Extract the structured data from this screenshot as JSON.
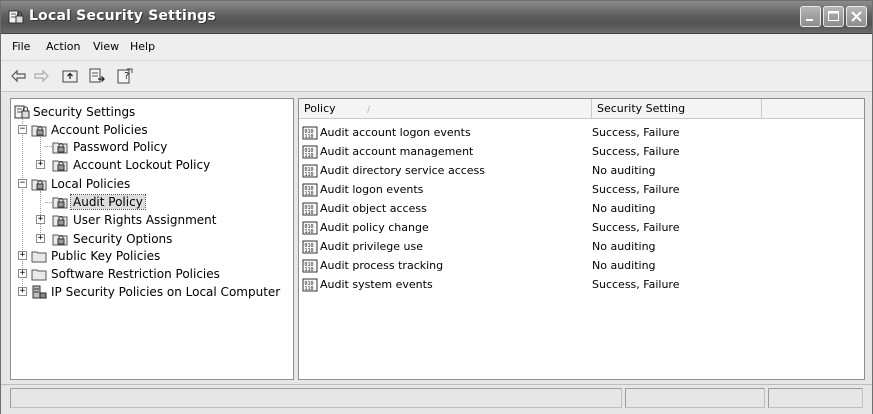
{
  "window": {
    "title": "Local Security Settings",
    "buttons": [
      "minimize-icon",
      "maximize-icon",
      "close-icon"
    ]
  },
  "menubar": {
    "items": [
      {
        "label": "File"
      },
      {
        "label": "Action"
      },
      {
        "label": "View"
      },
      {
        "label": "Help"
      }
    ]
  },
  "toolbar": {
    "icons": [
      "back-arrow-icon",
      "forward-arrow-icon",
      "up-folder-icon",
      "export-list-icon",
      "help-icon"
    ]
  },
  "tree": {
    "root": {
      "label": "Security Settings"
    },
    "account_policies": {
      "label": "Account Policies"
    },
    "password_policy": {
      "label": "Password Policy"
    },
    "account_lockout_policy": {
      "label": "Account Lockout Policy"
    },
    "local_policies": {
      "label": "Local Policies"
    },
    "audit_policy": {
      "label": "Audit Policy"
    },
    "user_rights_assignment": {
      "label": "User Rights Assignment"
    },
    "security_options": {
      "label": "Security Options"
    },
    "public_key_policies": {
      "label": "Public Key Policies"
    },
    "software_restriction_policies": {
      "label": "Software Restriction Policies"
    },
    "ip_security_policies": {
      "label": "IP Security Policies on Local Computer"
    }
  },
  "list": {
    "columns": [
      "Policy",
      "Security Setting"
    ],
    "sort_indicator": "/",
    "rows": [
      {
        "policy": "Audit account logon events",
        "setting": "Success, Failure"
      },
      {
        "policy": "Audit account management",
        "setting": "Success, Failure"
      },
      {
        "policy": "Audit directory service access",
        "setting": "No auditing"
      },
      {
        "policy": "Audit logon events",
        "setting": "Success, Failure"
      },
      {
        "policy": "Audit object access",
        "setting": "No auditing"
      },
      {
        "policy": "Audit policy change",
        "setting": "Success, Failure"
      },
      {
        "policy": "Audit privilege use",
        "setting": "No auditing"
      },
      {
        "policy": "Audit process tracking",
        "setting": "No auditing"
      },
      {
        "policy": "Audit system events",
        "setting": "Success, Failure"
      }
    ]
  },
  "colors": {
    "titlebar": "#5f5f5f",
    "window_bg": "#e6e6e6",
    "selection": "#dddddd"
  }
}
